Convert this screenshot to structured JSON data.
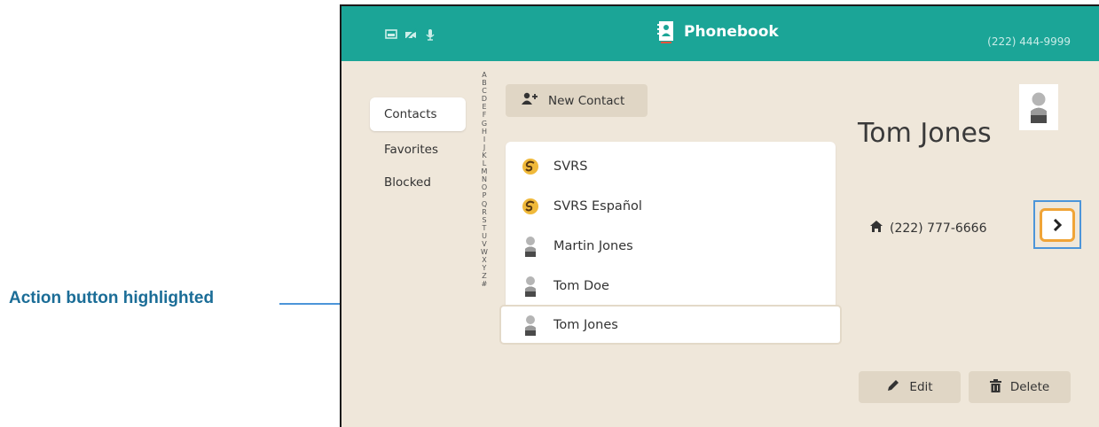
{
  "callout": {
    "label": "Action button highlighted"
  },
  "header": {
    "title": "Phonebook",
    "phone_number": "(222) 444-9999",
    "status_icons": [
      "screen-icon",
      "video-off-icon",
      "microphone-icon"
    ]
  },
  "nav": {
    "items": [
      {
        "label": "Contacts",
        "active": true
      },
      {
        "label": "Favorites",
        "active": false
      },
      {
        "label": "Blocked",
        "active": false
      }
    ]
  },
  "alphabet": [
    "A",
    "B",
    "C",
    "D",
    "E",
    "F",
    "G",
    "H",
    "I",
    "J",
    "K",
    "L",
    "M",
    "N",
    "O",
    "P",
    "Q",
    "R",
    "S",
    "T",
    "U",
    "V",
    "W",
    "X",
    "Y",
    "Z",
    "#"
  ],
  "new_contact": {
    "label": "New Contact"
  },
  "contacts": [
    {
      "name": "SVRS",
      "icon": "svrs-logo-icon",
      "selected": false
    },
    {
      "name": "SVRS Español",
      "icon": "svrs-logo-icon",
      "selected": false
    },
    {
      "name": "Martin Jones",
      "icon": "person-icon",
      "selected": false
    },
    {
      "name": "Tom Doe",
      "icon": "person-icon",
      "selected": false
    },
    {
      "name": "Tom Jones",
      "icon": "person-icon",
      "selected": true
    }
  ],
  "detail": {
    "name": "Tom Jones",
    "phone": "(222) 777-6666",
    "phone_type_icon": "home-icon"
  },
  "actions": {
    "edit": "Edit",
    "delete": "Delete"
  },
  "colors": {
    "header": "#1ba597",
    "background": "#efe7da",
    "button": "#e0d6c5",
    "focus": "#f0a437",
    "callout": "#1b6d97",
    "highlight": "#4c95d9"
  }
}
